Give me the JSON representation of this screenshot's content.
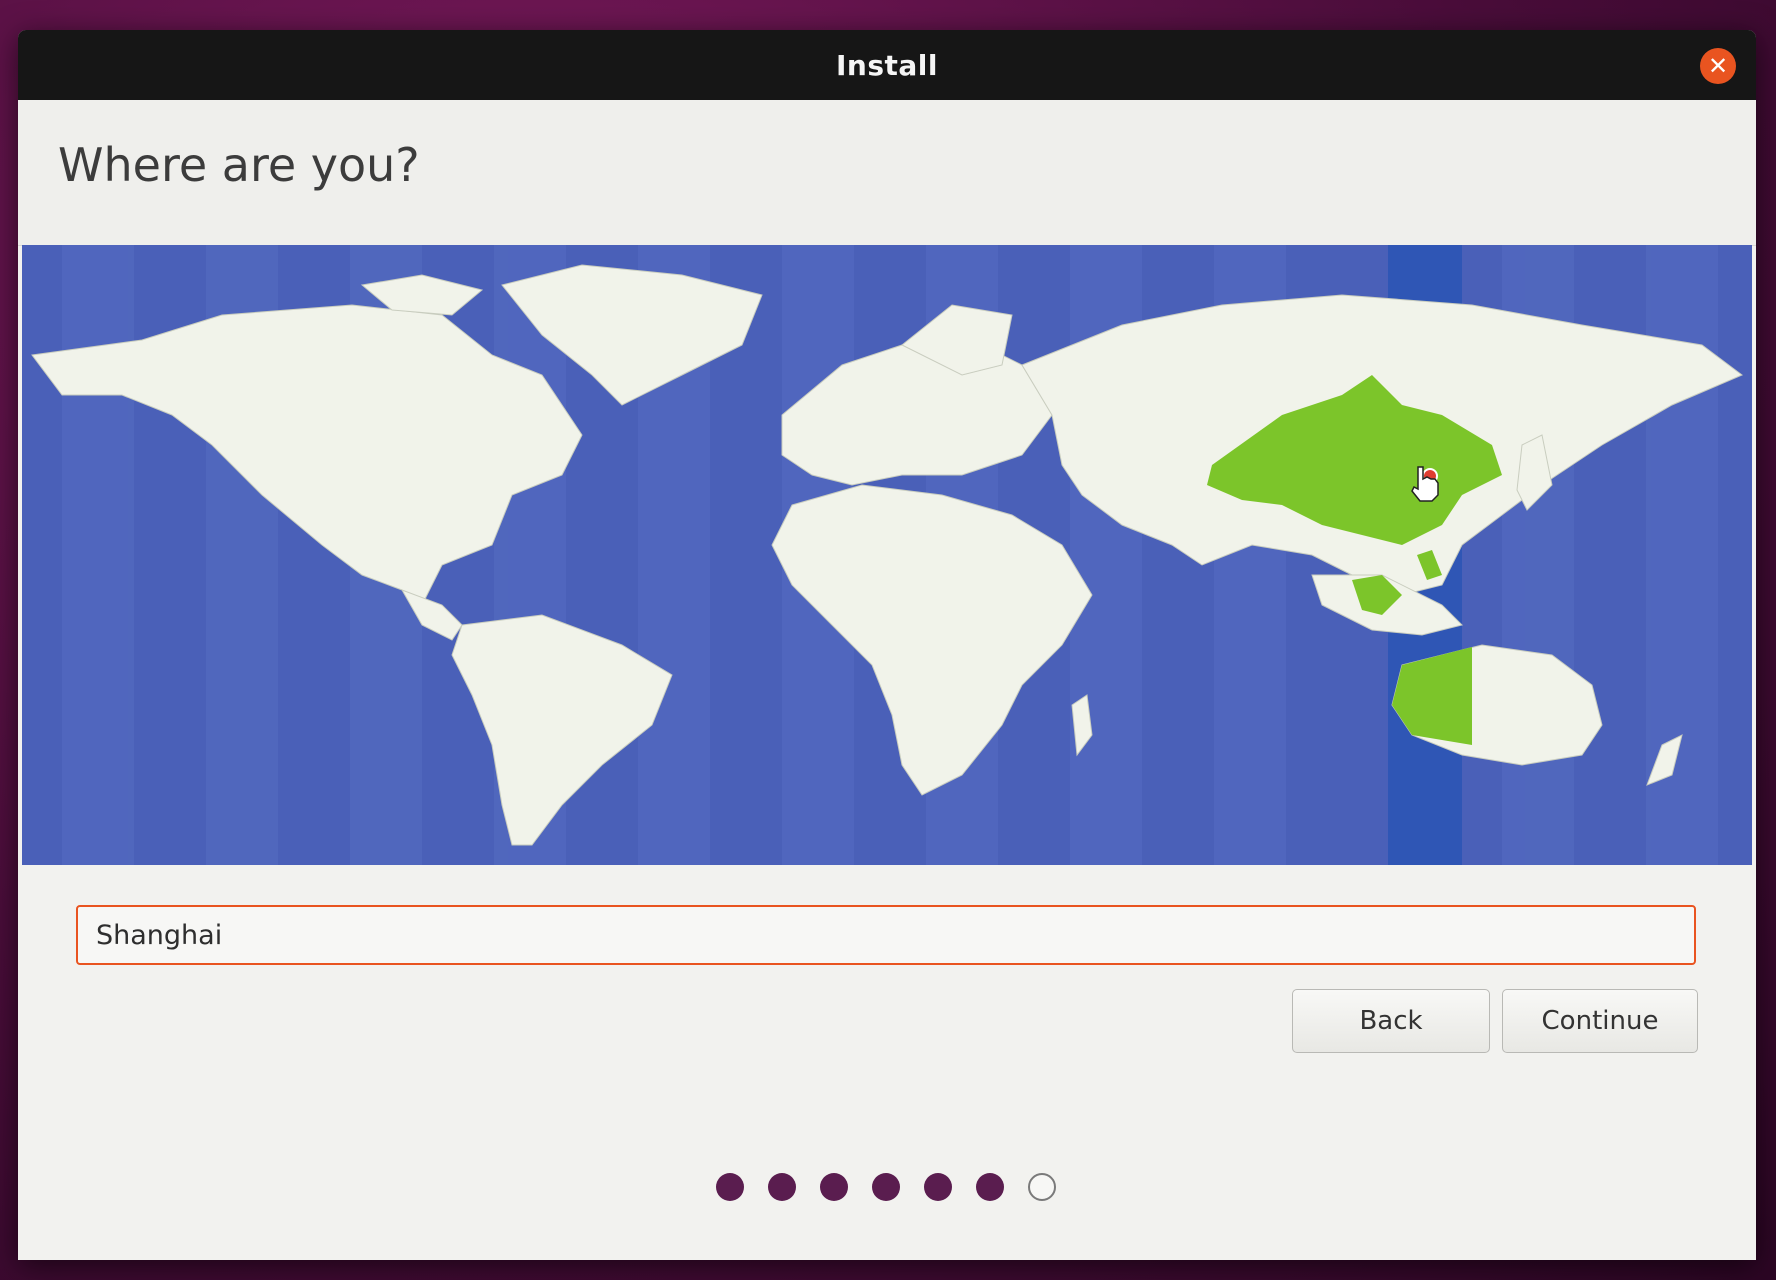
{
  "window": {
    "title": "Install",
    "close_icon": "close-icon"
  },
  "header": {
    "title": "Where are you?"
  },
  "map": {
    "selected_timezone_color": "#7cc52a",
    "highlight_band_color": "#2f56b5",
    "ocean_color": "#4a60b8",
    "land_color": "#f1f3ea",
    "marker_color": "#e03c31"
  },
  "location": {
    "value": "Shanghai"
  },
  "buttons": {
    "back_label": "Back",
    "continue_label": "Continue"
  },
  "progress": {
    "total_steps": 7,
    "completed_steps": 6
  },
  "colors": {
    "accent": "#e95420",
    "step_dot": "#5a1d4f"
  }
}
